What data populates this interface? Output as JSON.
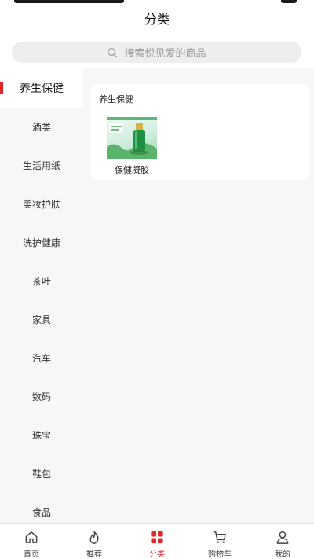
{
  "header": {
    "title": "分类"
  },
  "search": {
    "placeholder": "搜索悦见爱的商品"
  },
  "sidebar": {
    "items": [
      {
        "label": "养生保健",
        "active": true
      },
      {
        "label": "酒类"
      },
      {
        "label": "生活用纸"
      },
      {
        "label": "美妆护肤"
      },
      {
        "label": "洗护健康"
      },
      {
        "label": "茶叶"
      },
      {
        "label": "家具"
      },
      {
        "label": "汽车"
      },
      {
        "label": "数码"
      },
      {
        "label": "珠宝"
      },
      {
        "label": "鞋包"
      },
      {
        "label": "食品"
      }
    ]
  },
  "content": {
    "section_title": "养生保健",
    "products": [
      {
        "name": "保健凝胶",
        "icon": "product-bottle-image"
      }
    ]
  },
  "tabbar": {
    "items": [
      {
        "label": "首页",
        "icon": "home-icon"
      },
      {
        "label": "推荐",
        "icon": "flame-icon"
      },
      {
        "label": "分类",
        "icon": "grid-icon",
        "active": true
      },
      {
        "label": "购物车",
        "icon": "cart-icon"
      },
      {
        "label": "我的",
        "icon": "user-icon"
      }
    ]
  },
  "colors": {
    "accent": "#e0282c",
    "sidebar_bg": "#f7f7f7",
    "search_bg": "#eeeeee"
  }
}
